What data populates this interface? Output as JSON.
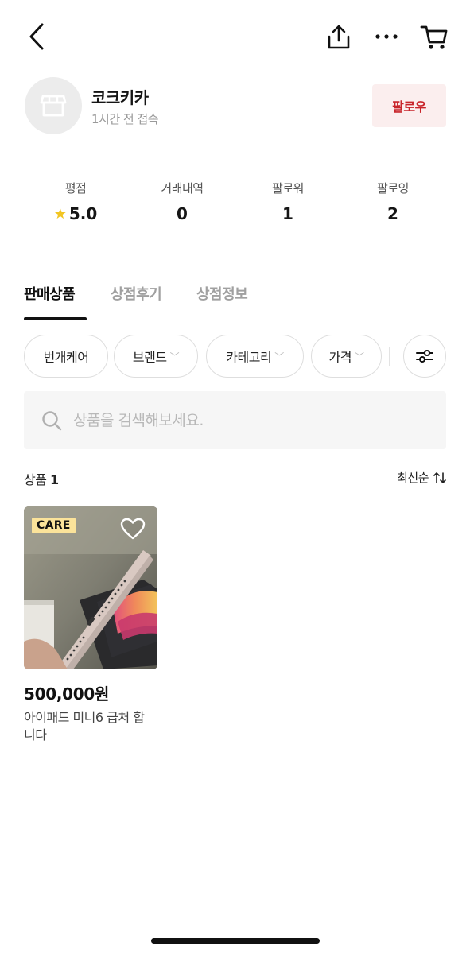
{
  "header": {
    "back_icon": "chevron-left-icon",
    "share_icon": "share-icon",
    "more_icon": "more-horizontal-icon",
    "cart_icon": "cart-icon"
  },
  "profile": {
    "avatar_icon": "store-icon",
    "name": "코크키카",
    "last_seen": "1시간 전 접속",
    "follow_label": "팔로우",
    "follow_color": "#c8242a"
  },
  "stats": [
    {
      "label": "평점",
      "value": "5.0",
      "icon": "star-icon"
    },
    {
      "label": "거래내역",
      "value": "0"
    },
    {
      "label": "팔로워",
      "value": "1"
    },
    {
      "label": "팔로잉",
      "value": "2"
    }
  ],
  "tabs": [
    {
      "label": "판매상품",
      "active": true
    },
    {
      "label": "상점후기",
      "active": false
    },
    {
      "label": "상점정보",
      "active": false
    }
  ],
  "filters": {
    "chips": [
      {
        "label": "번개케어",
        "has_dropdown": false
      },
      {
        "label": "브랜드",
        "has_dropdown": true
      },
      {
        "label": "카테고리",
        "has_dropdown": true
      },
      {
        "label": "가격",
        "has_dropdown": true
      }
    ],
    "settings_icon": "filter-sliders-icon"
  },
  "search": {
    "placeholder": "상품을 검색해보세요.",
    "value": "",
    "icon": "search-icon"
  },
  "list": {
    "count_label": "상품",
    "count_value": "1",
    "sort_label": "최신순",
    "sort_icon": "sort-arrows-icon"
  },
  "products": [
    {
      "badge": "CARE",
      "price": "500,000원",
      "title": "아이패드 미니6 급처 합니다",
      "wishlist_icon": "heart-outline-icon"
    }
  ]
}
